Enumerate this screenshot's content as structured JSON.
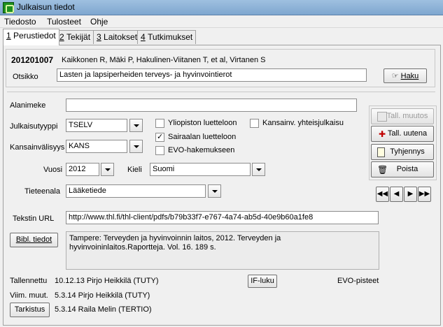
{
  "window": {
    "title": "Julkaisun tiedot"
  },
  "menu": [
    "Tiedosto",
    "Tulosteet",
    "Ohje"
  ],
  "tabs": [
    {
      "num": "1",
      "label": "Perustiedot"
    },
    {
      "num": "2",
      "label": "Tekijät"
    },
    {
      "num": "3",
      "label": "Laitokset"
    },
    {
      "num": "4",
      "label": "Tutkimukset"
    }
  ],
  "record": {
    "id": "201201007",
    "authors": "Kaikkonen R, Mäki P, Hakulinen-Viitanen T, et al, Virtanen S",
    "otsikko_label": "Otsikko",
    "otsikko_value": "Lasten ja lapsiperheiden terveys- ja hyvinvointierot",
    "haku_label": "Haku"
  },
  "form": {
    "alanimeke_label": "Alanimeke",
    "alanimeke_value": "",
    "julkaisutyyppi_label": "Julkaisutyyppi",
    "julkaisutyyppi_value": "TSELV",
    "kansainvalisyys_label": "Kansainvälisyys",
    "kansainvalisyys_value": "KANS",
    "vuosi_label": "Vuosi",
    "vuosi_value": "2012",
    "kieli_label": "Kieli",
    "kieli_value": "Suomi",
    "tieteenala_label": "Tieteenala",
    "tieteenala_value": "Lääketiede",
    "url_label": "Tekstin URL",
    "url_value": "http://www.thl.fi/thl-client/pdfs/b79b33f7-e767-4a74-ab5d-40e9b60a1fe8",
    "bibl_button": "Bibl. tiedot",
    "bibl_text": "Tampere: Terveyden ja hyvinvoinnin laitos, 2012. Terveyden ja hyvinvoininlaitos.Raportteja. Vol. 16. 189 s."
  },
  "checkboxes": {
    "yliopisto": {
      "label": "Yliopiston luetteloon",
      "checked": false
    },
    "sairaala": {
      "label": "Sairaalan luetteloon",
      "checked": true
    },
    "evo": {
      "label": "EVO-hakemukseen",
      "checked": false
    },
    "kansainv": {
      "label": "Kansainv. yhteisjulkaisu",
      "checked": false
    }
  },
  "side_buttons": {
    "tall_muutos": "Tall. muutos",
    "tall_uutena": "Tall. uutena",
    "tyhjennys": "Tyhjennys",
    "poista": "Poista"
  },
  "nav": {
    "first": "◀◀",
    "prev": "◀",
    "next": "▶",
    "last": "▶▶"
  },
  "footer": {
    "tallennettu_label": "Tallennettu",
    "tallennettu_value": "10.12.13 Pirjo Heikkilä (TUTY)",
    "viim_label": "Viim. muut.",
    "viim_value": "5.3.14 Pirjo Heikkilä (TUTY)",
    "tarkistus_button": "Tarkistus",
    "tarkistus_value": "5.3.14 Raila Melin (TERTIO)",
    "if_button": "IF-luku",
    "evo_pisteet": "EVO-pisteet"
  }
}
